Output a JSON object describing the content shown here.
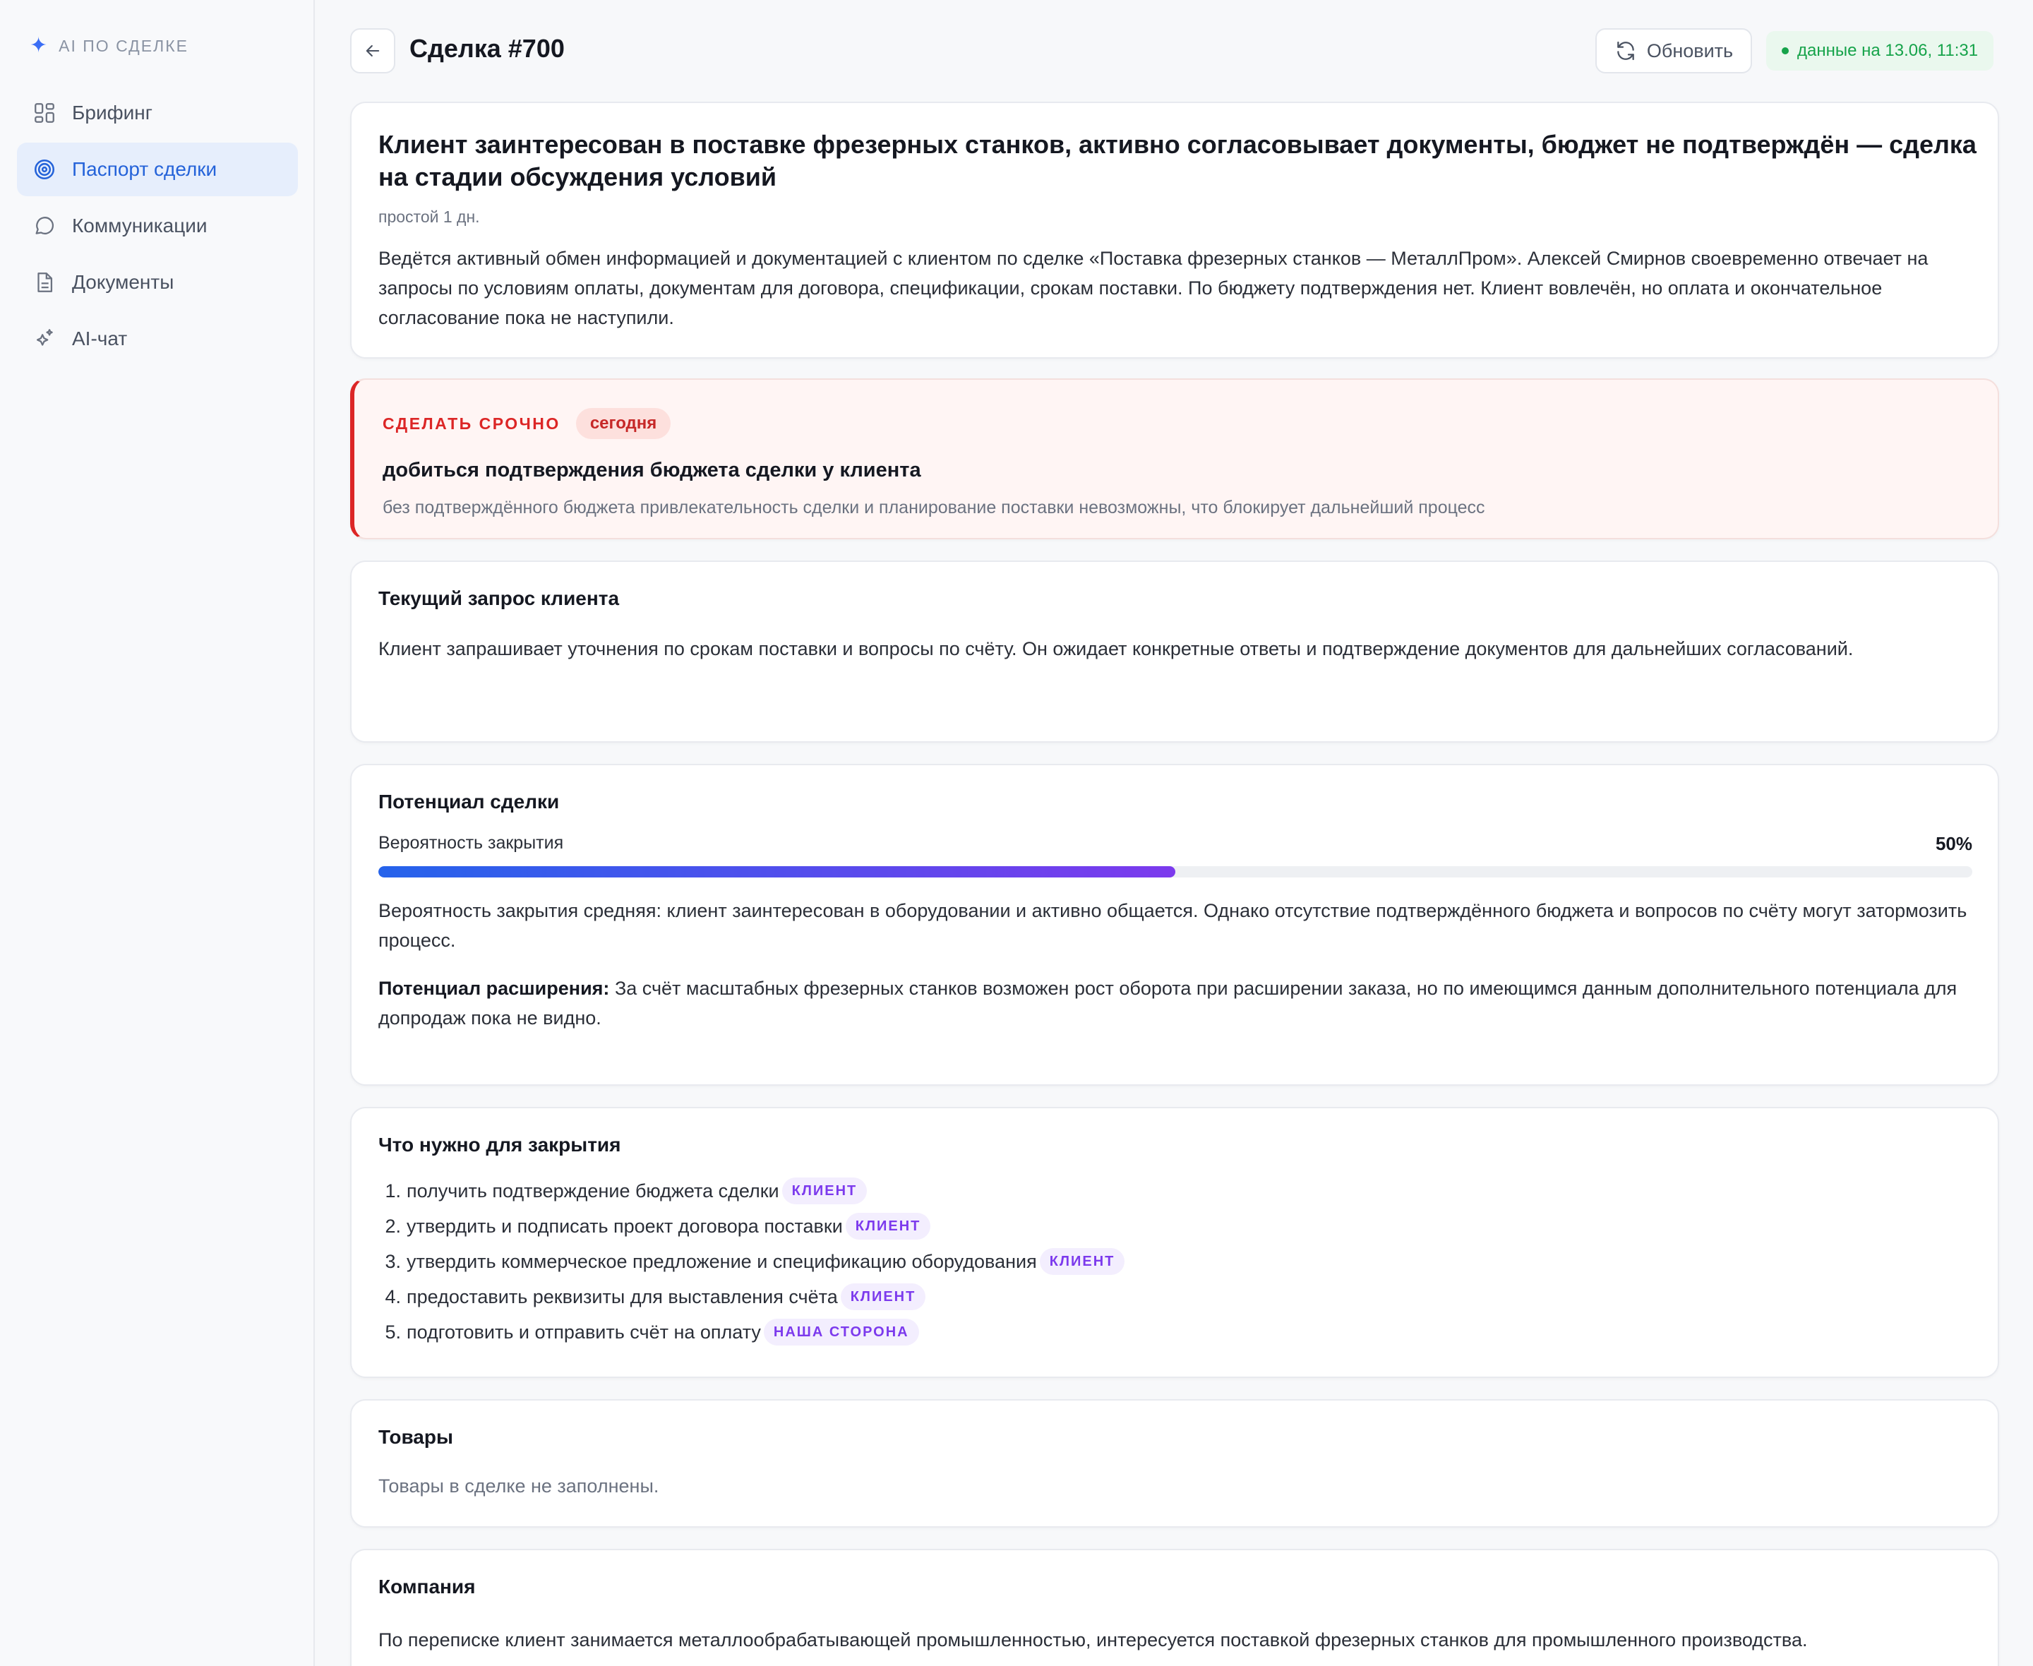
{
  "sidebar": {
    "brand": "AI по сделке",
    "items": [
      {
        "label": "Брифинг",
        "icon": "briefing-icon",
        "active": false
      },
      {
        "label": "Паспорт сделки",
        "icon": "target-icon",
        "active": true
      },
      {
        "label": "Коммуникации",
        "icon": "chat-icon",
        "active": false
      },
      {
        "label": "Документы",
        "icon": "document-icon",
        "active": false
      },
      {
        "label": "AI-чат",
        "icon": "sparkle-icon",
        "active": false
      }
    ]
  },
  "header": {
    "title": "Сделка #700",
    "refresh_label": "Обновить",
    "data_status": "данные на 13.06, 11:31",
    "status_color": "#16a34a"
  },
  "summary": {
    "headline": "Клиент заинтересован в поставке фрезерных станков, активно согласовывает документы, бюджет не подтверждён — сделка на стадии обсуждения условий",
    "idle": "простой 1 дн.",
    "text": "Ведётся активный обмен информацией и документацией с клиентом по сделке «Поставка фрезерных станков — МеталлПром». Алексей Смирнов своевременно отвечает на запросы по условиям оплаты, документам для договора, спецификации, срокам поставки. По бюджету подтверждения нет. Клиент вовлечён, но оплата и окончательное согласование пока не наступили."
  },
  "urgent": {
    "label": "Сделать срочно",
    "due": "сегодня",
    "title": "добиться подтверждения бюджета сделки у клиента",
    "note": "без подтверждённого бюджета привлекательность сделки и планирование поставки невозможны, что блокирует дальнейший процесс",
    "accent": "#dc2626"
  },
  "request": {
    "title": "Текущий запрос клиента",
    "text": "Клиент запрашивает уточнения по срокам поставки и вопросы по счёту. Он ожидает конкретные ответы и подтверждение документов для дальнейших согласований."
  },
  "potential": {
    "title": "Потенциал сделки",
    "prob_label": "Вероятность закрытия",
    "prob_value": "50%",
    "prob_fraction": 0.5,
    "text": "Вероятность закрытия средняя: клиент заинтересован в оборудовании и активно общается. Однако отсутствие подтверждённого бюджета и вопросов по счёту могут затормозить процесс.",
    "expansion_label": "Потенциал расширения:",
    "expansion_text": " За счёт масштабных фрезерных станков возможен рост оборота при расширении заказа, но по имеющимся данным дополнительного потенциала для допродаж пока не видно."
  },
  "closing": {
    "title": "Что нужно для закрытия",
    "items": [
      {
        "num": "1.",
        "text": "получить подтверждение бюджета сделки",
        "tag": "КЛИЕНТ"
      },
      {
        "num": "2.",
        "text": "утвердить и подписать проект договора поставки",
        "tag": "КЛИЕНТ"
      },
      {
        "num": "3.",
        "text": "утвердить коммерческое предложение и спецификацию оборудования",
        "tag": "КЛИЕНТ"
      },
      {
        "num": "4.",
        "text": "предоставить реквизиты для выставления счёта",
        "tag": "КЛИЕНТ"
      },
      {
        "num": "5.",
        "text": "подготовить и отправить счёт на оплату",
        "tag": "НАША СТОРОНА"
      }
    ]
  },
  "goods": {
    "title": "Товары",
    "empty": "Товары в сделке не заполнены."
  },
  "company": {
    "title": "Компания",
    "text": "По переписке клиент занимается металлообрабатывающей промышленностью, интересуется поставкой фрезерных станков для промышленного производства."
  }
}
